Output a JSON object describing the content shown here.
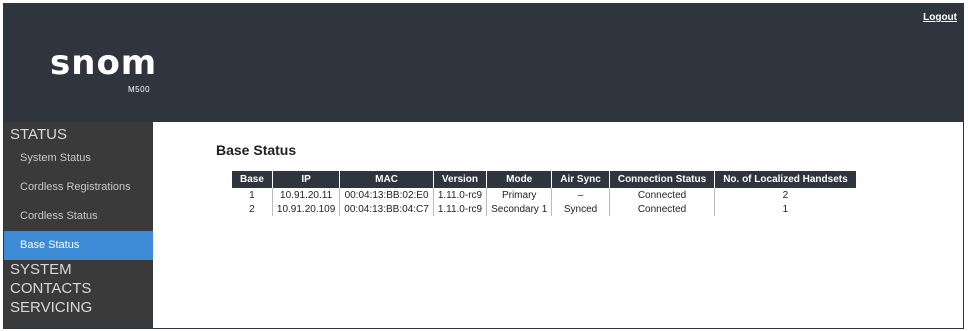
{
  "header": {
    "logo": "snom",
    "model": "M500",
    "logout_label": "Logout"
  },
  "sidebar": {
    "status_label": "STATUS",
    "items": [
      {
        "label": "System Status"
      },
      {
        "label": "Cordless Registrations"
      },
      {
        "label": "Cordless Status"
      },
      {
        "label": "Base Status"
      }
    ],
    "system_label": "SYSTEM",
    "contacts_label": "CONTACTS",
    "servicing_label": "SERVICING"
  },
  "main": {
    "title": "Base Status",
    "table": {
      "headers": [
        "Base",
        "IP",
        "MAC",
        "Version",
        "Mode",
        "Air Sync",
        "Connection Status",
        "No. of Localized Handsets"
      ],
      "rows": [
        [
          "1",
          "10.91.20.11",
          "00:04:13:BB:02:E0",
          "1.11.0-rc9",
          "Primary",
          "–",
          "Connected",
          "2"
        ],
        [
          "2",
          "10.91.20.109",
          "00:04:13:BB:04:C7",
          "1.11.0-rc9",
          "Secondary 1",
          "Synced",
          "Connected",
          "1"
        ]
      ]
    }
  },
  "colors": {
    "header_bg": "#2f353e",
    "sidebar_bg": "#3a3a3a",
    "active_item": "#3d8bd6"
  }
}
